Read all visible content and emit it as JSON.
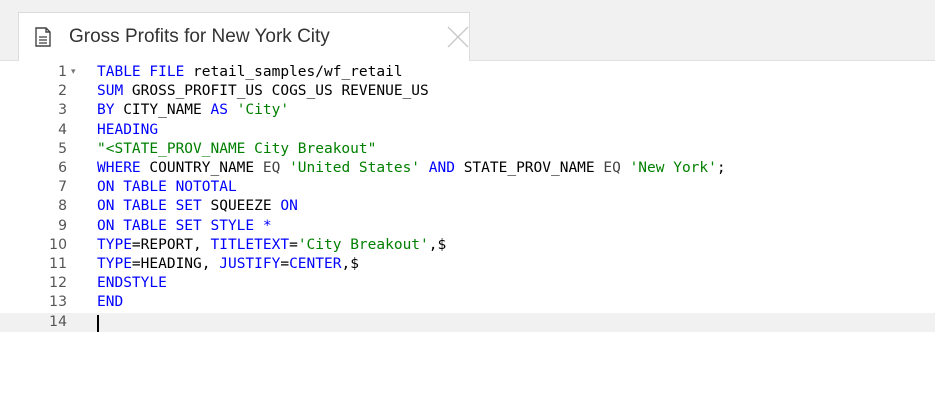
{
  "tab": {
    "title": "Gross Profits for New York City",
    "icon": "document-icon",
    "close_icon": "close-icon"
  },
  "editor": {
    "fold_marker": "▾",
    "lines": [
      {
        "num": "1",
        "tokens": [
          {
            "t": "TABLE FILE",
            "c": "kw"
          },
          {
            "t": " retail_samples/wf_retail",
            "c": ""
          }
        ]
      },
      {
        "num": "2",
        "tokens": [
          {
            "t": "SUM",
            "c": "kw"
          },
          {
            "t": " GROSS_PROFIT_US COGS_US REVENUE_US",
            "c": ""
          }
        ]
      },
      {
        "num": "3",
        "tokens": [
          {
            "t": "BY",
            "c": "kw"
          },
          {
            "t": " CITY_NAME ",
            "c": ""
          },
          {
            "t": "AS",
            "c": "kw"
          },
          {
            "t": " ",
            "c": ""
          },
          {
            "t": "'City'",
            "c": "str"
          }
        ]
      },
      {
        "num": "4",
        "tokens": [
          {
            "t": "HEADING",
            "c": "kw"
          }
        ]
      },
      {
        "num": "5",
        "tokens": [
          {
            "t": "\"<STATE_PROV_NAME City Breakout\"",
            "c": "str"
          }
        ]
      },
      {
        "num": "6",
        "tokens": [
          {
            "t": "WHERE",
            "c": "kw"
          },
          {
            "t": " COUNTRY_NAME ",
            "c": ""
          },
          {
            "t": "EQ",
            "c": "op"
          },
          {
            "t": " ",
            "c": ""
          },
          {
            "t": "'United States'",
            "c": "str"
          },
          {
            "t": " ",
            "c": ""
          },
          {
            "t": "AND",
            "c": "kw"
          },
          {
            "t": " STATE_PROV_NAME ",
            "c": ""
          },
          {
            "t": "EQ",
            "c": "op"
          },
          {
            "t": " ",
            "c": ""
          },
          {
            "t": "'New York'",
            "c": "str"
          },
          {
            "t": ";",
            "c": ""
          }
        ]
      },
      {
        "num": "7",
        "tokens": [
          {
            "t": "ON TABLE NOTOTAL",
            "c": "kw"
          }
        ]
      },
      {
        "num": "8",
        "tokens": [
          {
            "t": "ON TABLE SET",
            "c": "kw"
          },
          {
            "t": " SQUEEZE ",
            "c": ""
          },
          {
            "t": "ON",
            "c": "kw"
          }
        ]
      },
      {
        "num": "9",
        "tokens": [
          {
            "t": "ON TABLE SET STYLE *",
            "c": "kw"
          }
        ]
      },
      {
        "num": "10",
        "tokens": [
          {
            "t": "TYPE",
            "c": "kw"
          },
          {
            "t": "=REPORT, ",
            "c": ""
          },
          {
            "t": "TITLETEXT",
            "c": "kw"
          },
          {
            "t": "=",
            "c": ""
          },
          {
            "t": "'City Breakout'",
            "c": "str"
          },
          {
            "t": ",$",
            "c": ""
          }
        ]
      },
      {
        "num": "11",
        "tokens": [
          {
            "t": "TYPE",
            "c": "kw"
          },
          {
            "t": "=HEADING, ",
            "c": ""
          },
          {
            "t": "JUSTIFY",
            "c": "kw"
          },
          {
            "t": "=",
            "c": ""
          },
          {
            "t": "CENTER",
            "c": "kw"
          },
          {
            "t": ",$",
            "c": ""
          }
        ]
      },
      {
        "num": "12",
        "tokens": [
          {
            "t": "ENDSTYLE",
            "c": "kw"
          }
        ]
      },
      {
        "num": "13",
        "tokens": [
          {
            "t": "END",
            "c": "kw"
          }
        ]
      },
      {
        "num": "14",
        "tokens": []
      }
    ],
    "active_line": 14
  }
}
